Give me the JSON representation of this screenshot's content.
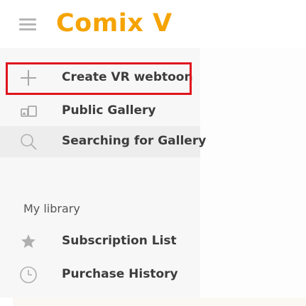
{
  "header": {
    "menu_icon": "hamburger-menu-icon",
    "title": "Comix V",
    "title_color": "#f5a300"
  },
  "sidebar": {
    "items": [
      {
        "label": "Create VR webtoon",
        "icon": "plus-icon",
        "highlighted": true
      },
      {
        "label": "Public Gallery",
        "icon": "gallery-icon"
      },
      {
        "label": "Searching for Gallery",
        "icon": "search-icon",
        "selected": true
      }
    ],
    "library_section": {
      "title": "My library",
      "items": [
        {
          "label": "Subscription List",
          "icon": "star-icon"
        },
        {
          "label": "Purchase History",
          "icon": "clock-icon"
        }
      ]
    }
  },
  "colors": {
    "highlight_border": "#e0141e",
    "sidebar_bg": "#f7f7f7",
    "selected_bg": "#ededed"
  }
}
